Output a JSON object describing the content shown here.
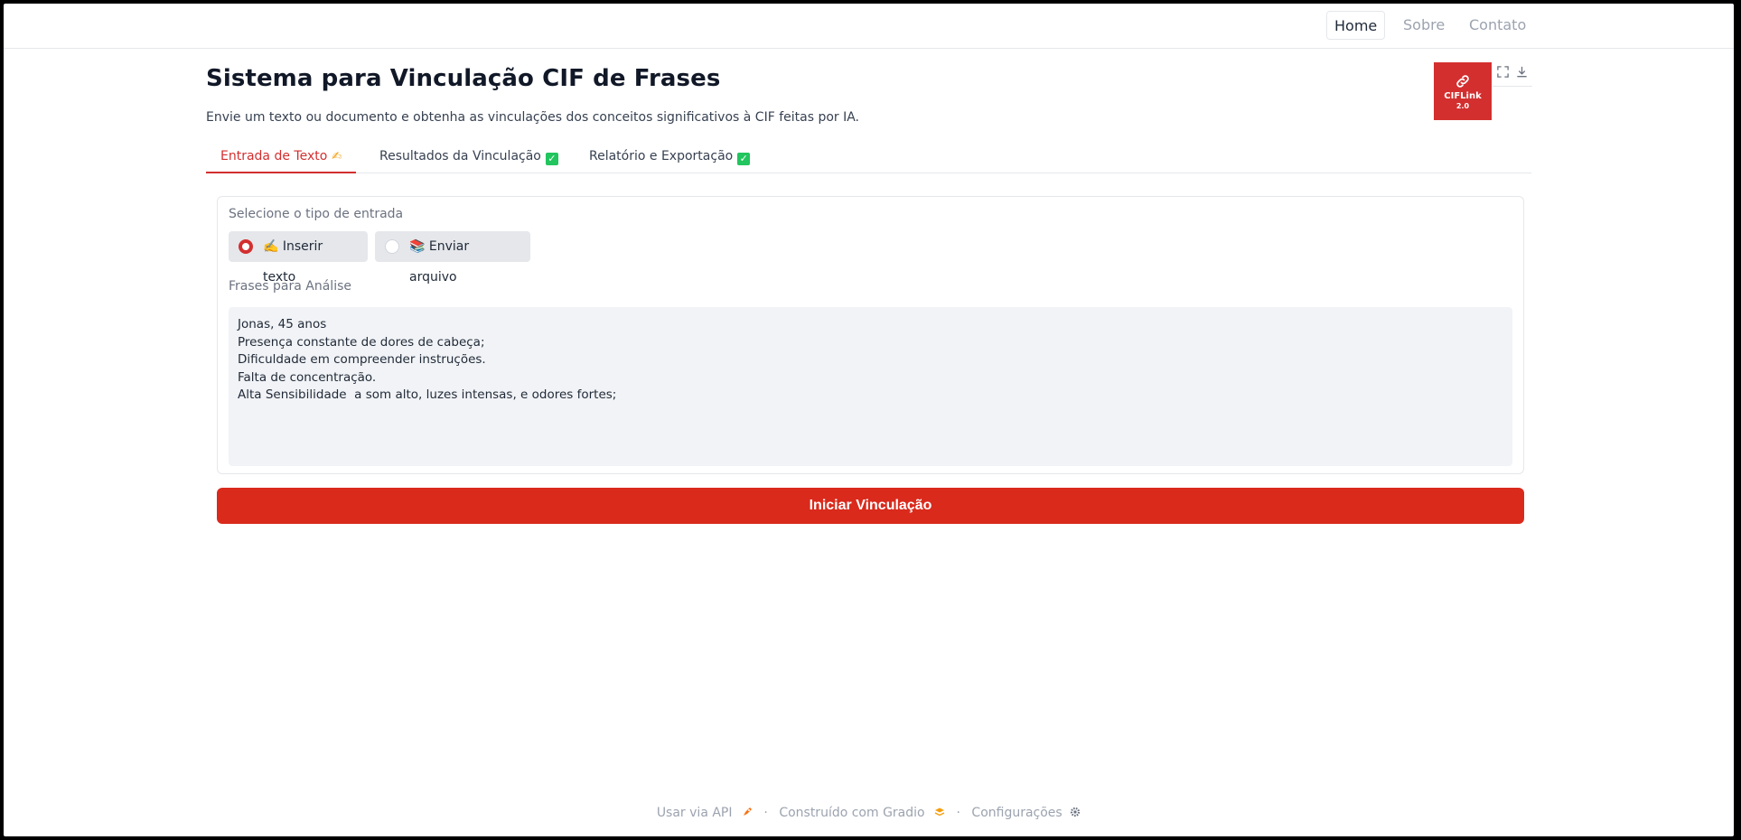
{
  "nav": {
    "items": [
      {
        "label": "Home",
        "active": true
      },
      {
        "label": "Sobre",
        "active": false
      },
      {
        "label": "Contato",
        "active": false
      }
    ]
  },
  "header": {
    "title": "Sistema para Vinculação CIF de Frases",
    "subtitle": "Envie um texto ou documento e obtenha as vinculações dos conceitos significativos à CIF feitas por IA.",
    "logo": {
      "name": "CIFLink",
      "version": "2.0",
      "color": "#d32f2f",
      "icon": "link-icon"
    }
  },
  "tabs": [
    {
      "label": "Entrada de Texto",
      "emoji": "✍",
      "active": true
    },
    {
      "label": "Resultados da Vinculação",
      "emoji": "✓",
      "active": false
    },
    {
      "label": "Relatório e Exportação",
      "emoji": "✓",
      "active": false
    }
  ],
  "input_type": {
    "label": "Selecione o tipo de entrada",
    "options": [
      {
        "label": "✍️ Inserir texto",
        "selected": true
      },
      {
        "label": "📚 Enviar arquivo",
        "selected": false
      }
    ]
  },
  "phrases": {
    "label": "Frases para Análise",
    "value": "Jonas, 45 anos\nPresença constante de dores de cabeça;\nDificuldade em compreender instruções.\nFalta de concentração.\nAlta Sensibilidade  a som alto, luzes intensas, e odores fortes;"
  },
  "submit_button": {
    "label": "Iniciar Vinculação",
    "color": "#d92a1c"
  },
  "footer": {
    "api_label": "Usar via API",
    "built_label": "Construído com Gradio",
    "settings_label": "Configurações"
  }
}
